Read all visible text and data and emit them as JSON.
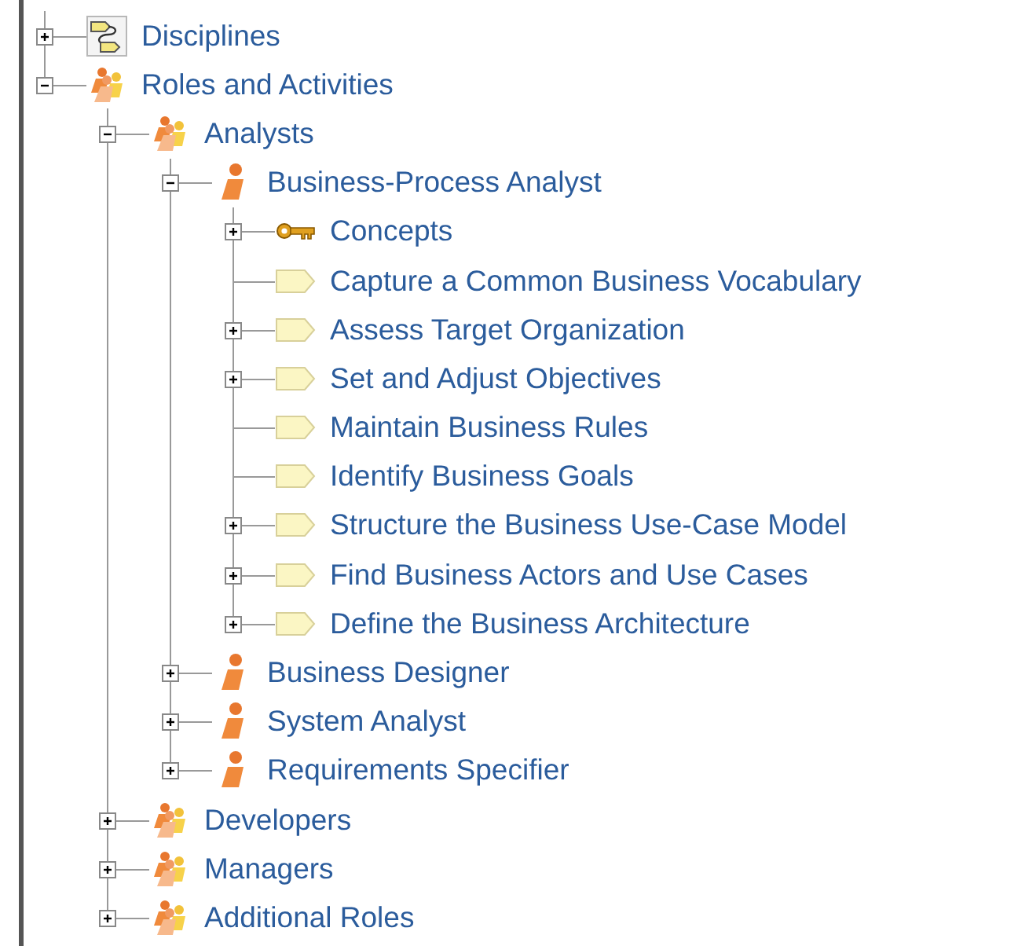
{
  "tree": [
    {
      "label": "Disciplines",
      "kind": "discipline",
      "expanded": false
    },
    {
      "label": "Roles and Activities",
      "kind": "role-group",
      "expanded": true,
      "children": [
        {
          "label": "Analysts",
          "kind": "role-group",
          "expanded": true,
          "children": [
            {
              "label": "Business-Process Analyst",
              "kind": "role",
              "expanded": true,
              "children": [
                {
                  "label": "Concepts",
                  "kind": "key",
                  "expanded": false
                },
                {
                  "label": "Capture a Common Business Vocabulary",
                  "kind": "activity"
                },
                {
                  "label": "Assess Target Organization",
                  "kind": "activity",
                  "expanded": false
                },
                {
                  "label": "Set and Adjust Objectives",
                  "kind": "activity",
                  "expanded": false
                },
                {
                  "label": "Maintain Business Rules",
                  "kind": "activity"
                },
                {
                  "label": "Identify Business Goals",
                  "kind": "activity"
                },
                {
                  "label": "Structure the Business Use-Case Model",
                  "kind": "activity",
                  "expanded": false
                },
                {
                  "label": "Find Business Actors and Use Cases",
                  "kind": "activity",
                  "expanded": false
                },
                {
                  "label": "Define the Business Architecture",
                  "kind": "activity",
                  "expanded": false
                }
              ]
            },
            {
              "label": "Business Designer",
              "kind": "role",
              "expanded": false
            },
            {
              "label": "System Analyst",
              "kind": "role",
              "expanded": false
            },
            {
              "label": "Requirements Specifier",
              "kind": "role",
              "expanded": false
            }
          ]
        },
        {
          "label": "Developers",
          "kind": "role-group",
          "expanded": false
        },
        {
          "label": "Managers",
          "kind": "role-group",
          "expanded": false
        },
        {
          "label": "Additional Roles",
          "kind": "role-group",
          "expanded": false
        }
      ]
    }
  ]
}
